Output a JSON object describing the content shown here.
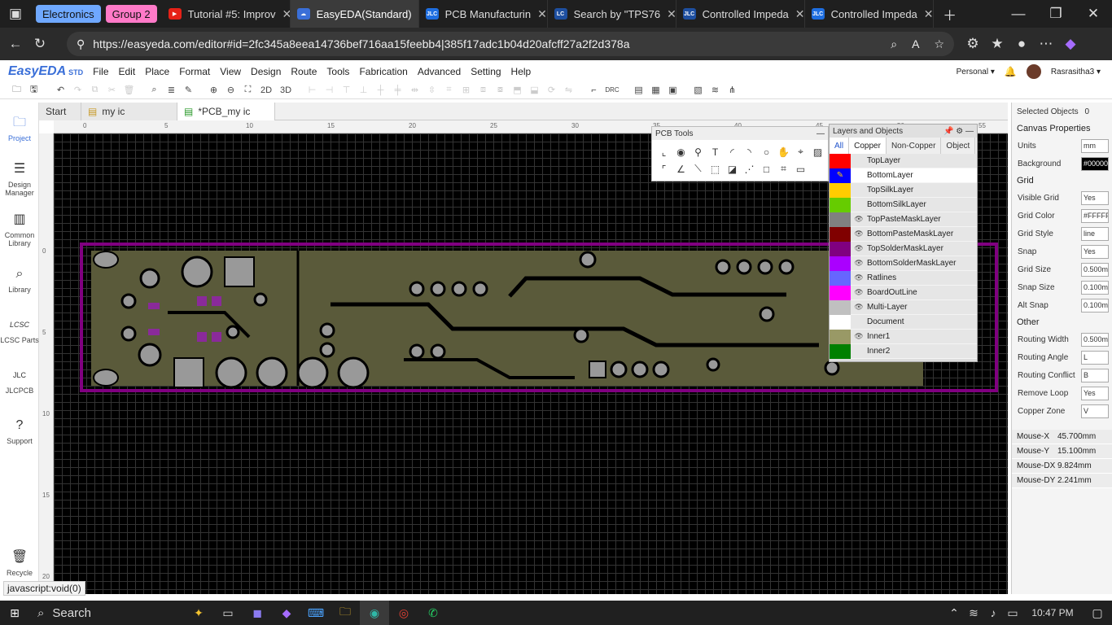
{
  "browser": {
    "tab_groups": [
      {
        "label": "Electronics",
        "color": "#6fa8ff"
      },
      {
        "label": "Group 2",
        "color": "#ff7ac8"
      }
    ],
    "tabs": [
      {
        "label": "Tutorial #5: Improv",
        "icon": "youtube-icon",
        "icon_color": "#e62117"
      },
      {
        "label": "EasyEDA(Standard)",
        "icon": "easyeda-icon",
        "icon_color": "#3a6fd8",
        "active": true
      },
      {
        "label": "PCB Manufacturin",
        "icon": "jlc-icon",
        "icon_color": "#1e6ee0"
      },
      {
        "label": "Search by \"TPS76",
        "icon": "lcsc-icon",
        "icon_color": "#1e4fa0"
      },
      {
        "label": "Controlled Impeda",
        "icon": "jlc-icon",
        "icon_color": "#1e4fa0"
      },
      {
        "label": "Controlled Impeda",
        "icon": "jlc-icon",
        "icon_color": "#1e6ee0"
      }
    ],
    "url": "https://easyeda.com/editor#id=2fc345a8eea14736bef716aa15feebb4|385f17adc1b04d20afcff27a2f2d378a"
  },
  "app": {
    "logo": "EasyEDA",
    "logo_suffix": "STD",
    "menu": [
      "File",
      "Edit",
      "Place",
      "Format",
      "View",
      "Design",
      "Route",
      "Tools",
      "Fabrication",
      "Advanced",
      "Setting",
      "Help"
    ],
    "account": "Personal",
    "user": "Rasrasitha3"
  },
  "toolbar": {
    "label_2d": "2D",
    "label_3d": "3D",
    "label_drc": "DRC"
  },
  "left_sidebar": [
    {
      "label": "Project",
      "icon": "folder-icon"
    },
    {
      "label": "Design Manager",
      "icon": "list-icon"
    },
    {
      "label": "Common Library",
      "icon": "chip-icon"
    },
    {
      "label": "Library",
      "icon": "search-library-icon"
    },
    {
      "label": "LCSC Parts",
      "icon": "lcsc-logo-icon"
    },
    {
      "label": "JLCPCB",
      "icon": "jlc-logo-icon"
    },
    {
      "label": "Support",
      "icon": "help-icon"
    },
    {
      "label": "Recycle",
      "icon": "trash-icon"
    }
  ],
  "doc_tabs": [
    {
      "label": "Start"
    },
    {
      "label": "my ic"
    },
    {
      "label": "*PCB_my ic",
      "active": true
    }
  ],
  "ruler": {
    "top_ticks": [
      "0",
      "5",
      "10",
      "15",
      "20",
      "25",
      "30",
      "35",
      "40",
      "45",
      "50",
      "55"
    ],
    "left_ticks": [
      "0",
      "5",
      "10",
      "15",
      "20"
    ]
  },
  "pcb_tools": {
    "title": "PCB Tools"
  },
  "layers_panel": {
    "title": "Layers and Objects",
    "tabs": [
      "All",
      "Copper",
      "Non-Copper",
      "Object"
    ],
    "layers": [
      {
        "name": "TopLayer",
        "color": "#ff0000",
        "eye": false
      },
      {
        "name": "BottomLayer",
        "color": "#0000ff",
        "eye": false,
        "editing": true
      },
      {
        "name": "TopSilkLayer",
        "color": "#ffcc00",
        "eye": false
      },
      {
        "name": "BottomSilkLayer",
        "color": "#66cc00",
        "eye": false
      },
      {
        "name": "TopPasteMaskLayer",
        "color": "#808080",
        "eye": true
      },
      {
        "name": "BottomPasteMaskLayer",
        "color": "#800000",
        "eye": true
      },
      {
        "name": "TopSolderMaskLayer",
        "color": "#800080",
        "eye": true
      },
      {
        "name": "BottomSolderMaskLayer",
        "color": "#aa00ff",
        "eye": true
      },
      {
        "name": "Ratlines",
        "color": "#6666ff",
        "eye": true
      },
      {
        "name": "BoardOutLine",
        "color": "#ff00ff",
        "eye": true
      },
      {
        "name": "Multi-Layer",
        "color": "#c0c0c0",
        "eye": true
      },
      {
        "name": "Document",
        "color": "#ffffff",
        "eye": false
      },
      {
        "name": "Inner1",
        "color": "#999966",
        "eye": true
      },
      {
        "name": "Inner2",
        "color": "#008000",
        "eye": false
      }
    ]
  },
  "properties": {
    "selected_label": "Selected Objects",
    "selected_count": "0",
    "canvas_title": "Canvas Properties",
    "rows": [
      {
        "label": "Units",
        "value": "mm"
      },
      {
        "label": "Background",
        "value": "#000000"
      }
    ],
    "grid_title": "Grid",
    "grid_rows": [
      {
        "label": "Visible Grid",
        "value": "Yes"
      },
      {
        "label": "Grid Color",
        "value": "#FFFFFF"
      },
      {
        "label": "Grid Style",
        "value": "line"
      },
      {
        "label": "Snap",
        "value": "Yes"
      },
      {
        "label": "Grid Size",
        "value": "0.500mm"
      },
      {
        "label": "Snap Size",
        "value": "0.100mm"
      },
      {
        "label": "Alt Snap",
        "value": "0.100mm"
      }
    ],
    "other_title": "Other",
    "other_rows": [
      {
        "label": "Routing Width",
        "value": "0.500mm"
      },
      {
        "label": "Routing Angle",
        "value": "L"
      },
      {
        "label": "Routing Conflict",
        "value": "B"
      },
      {
        "label": "Remove Loop",
        "value": "Yes"
      },
      {
        "label": "Copper Zone",
        "value": "V"
      }
    ],
    "mouse": [
      {
        "label": "Mouse-X",
        "value": "45.700mm"
      },
      {
        "label": "Mouse-Y",
        "value": "15.100mm"
      },
      {
        "label": "Mouse-DX",
        "value": "9.824mm"
      },
      {
        "label": "Mouse-DY",
        "value": "2.241mm"
      }
    ]
  },
  "status_text": "javascript:void(0)",
  "taskbar": {
    "search": "Search",
    "time": "10:47 PM"
  }
}
